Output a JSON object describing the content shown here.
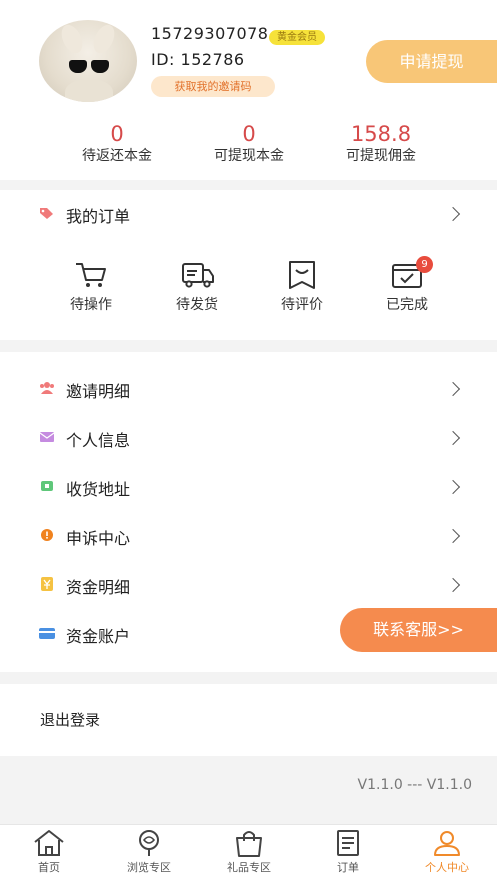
{
  "profile": {
    "phone": "15729307078",
    "vip_badge": "黄金会员",
    "id_text": "ID:  152786",
    "invite_code_button": "获取我的邀请码",
    "withdraw_button": "申请提现"
  },
  "stats": [
    {
      "value": "0",
      "label": "待返还本金"
    },
    {
      "value": "0",
      "label": "可提现本金"
    },
    {
      "value": "158.8",
      "label": "可提现佣金"
    }
  ],
  "orders": {
    "title": "我的订单",
    "items": [
      {
        "label": "待操作",
        "icon": "cart-icon"
      },
      {
        "label": "待发货",
        "icon": "truck-icon"
      },
      {
        "label": "待评价",
        "icon": "review-icon"
      },
      {
        "label": "已完成",
        "icon": "completed-icon"
      }
    ],
    "completed_badge": "9"
  },
  "menu": [
    {
      "label": "邀请明细",
      "icon": "invite-users-icon",
      "color": "#f07a7a"
    },
    {
      "label": "个人信息",
      "icon": "envelope-icon",
      "color": "#c58be0"
    },
    {
      "label": "收货地址",
      "icon": "address-icon",
      "color": "#5fc77a"
    },
    {
      "label": "申诉中心",
      "icon": "alert-icon",
      "color": "#f0821e"
    },
    {
      "label": "资金明细",
      "icon": "yuan-icon",
      "color": "#f5c242"
    },
    {
      "label": "资金账户",
      "icon": "card-icon",
      "color": "#4a90e2"
    }
  ],
  "service_button": "联系客服>>",
  "logout": "退出登录",
  "version": "V1.1.0 --- V1.1.0",
  "tabs": [
    {
      "label": "首页",
      "icon": "home-icon"
    },
    {
      "label": "浏览专区",
      "icon": "browse-icon"
    },
    {
      "label": "礼品专区",
      "icon": "gift-bag-icon"
    },
    {
      "label": "订单",
      "icon": "order-list-icon"
    },
    {
      "label": "个人中心",
      "icon": "profile-icon",
      "active": true
    }
  ],
  "colors": {
    "accent": "#f08a2a",
    "stat_value": "#d64a4a",
    "withdraw_bg": "#f8c677",
    "service_bg": "#f58b4e"
  }
}
